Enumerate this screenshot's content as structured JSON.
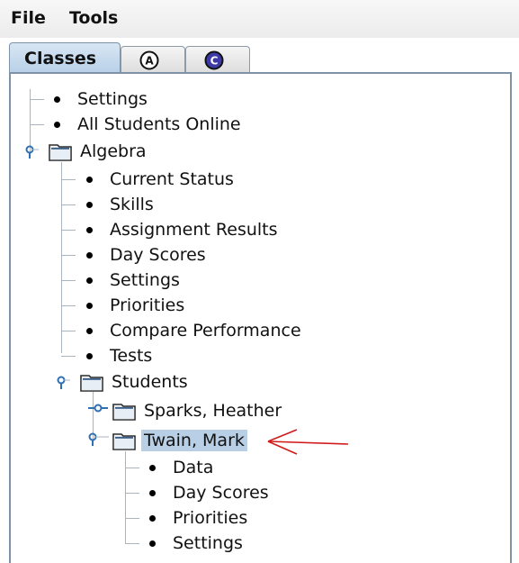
{
  "menubar": {
    "file": "File",
    "tools": "Tools"
  },
  "tabs": {
    "classes": "Classes",
    "tab_a_letter": "A",
    "tab_c_letter": "C"
  },
  "tree": {
    "settings": "Settings",
    "all_students_online": "All Students Online",
    "algebra": {
      "label": "Algebra",
      "current_status": "Current Status",
      "skills": "Skills",
      "assignment_results": "Assignment Results",
      "day_scores": "Day Scores",
      "settings": "Settings",
      "priorities": "Priorities",
      "compare_performance": "Compare Performance",
      "tests": "Tests",
      "students": {
        "label": "Students",
        "sparks_heather": "Sparks, Heather",
        "twain_mark": {
          "label": "Twain, Mark",
          "data": "Data",
          "day_scores": "Day Scores",
          "priorities": "Priorities",
          "settings": "Settings"
        }
      }
    }
  },
  "colors": {
    "selection": "#b8cfe5",
    "annotation_arrow": "#d11b1b",
    "tree_lines": "#a9b4bf",
    "handle": "#2f6fb5"
  }
}
